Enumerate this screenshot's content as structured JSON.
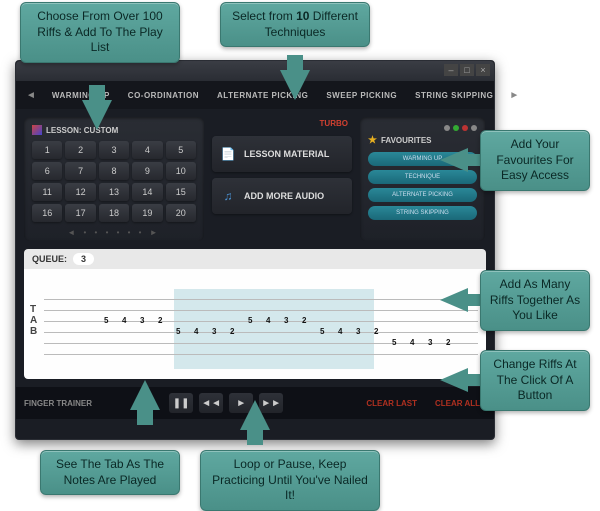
{
  "callouts": {
    "riffs": "Choose From Over 100 Riffs & Add To The Play List",
    "techniques_pre": "Select from ",
    "techniques_num": "10",
    "techniques_post": " Different Techniques",
    "favourites": "Add Your Favourites For Easy Access",
    "addmany": "Add As Many Riffs Together As You Like",
    "changeriffs": "Change Riffs At The Click Of A Button",
    "seetab": "See The Tab As The Notes Are Played",
    "loop": "Loop or Pause, Keep Practicing Until You've Nailed It!"
  },
  "nav": {
    "tabs": [
      "WARMING UP",
      "CO-ORDINATION",
      "ALTERNATE PICKING",
      "SWEEP PICKING",
      "STRING SKIPPING"
    ]
  },
  "lesson": {
    "title": "LESSON: CUSTOM",
    "numbers": [
      "1",
      "2",
      "3",
      "4",
      "5",
      "6",
      "7",
      "8",
      "9",
      "10",
      "11",
      "12",
      "13",
      "14",
      "15",
      "16",
      "17",
      "18",
      "19",
      "20"
    ]
  },
  "turbo": "TURBO",
  "actions": {
    "material": "LESSON MATERIAL",
    "addaudio": "ADD MORE AUDIO"
  },
  "fav": {
    "title": "FAVOURITES",
    "items": [
      "WARMING UP",
      "TECHNIQUE",
      "ALTERNATE PICKING",
      "STRING SKIPPING"
    ]
  },
  "queue": {
    "label": "QUEUE:",
    "count": "3"
  },
  "tab_letters": [
    "T",
    "A",
    "B"
  ],
  "controls": {
    "label": "FINGER TRAINER",
    "clearlast": "CLEAR LAST",
    "clearall": "CLEAR ALL"
  },
  "tab_notes": [
    {
      "row": 2,
      "col": 0,
      "v": "5"
    },
    {
      "row": 2,
      "col": 1,
      "v": "4"
    },
    {
      "row": 2,
      "col": 2,
      "v": "3"
    },
    {
      "row": 2,
      "col": 3,
      "v": "2"
    },
    {
      "row": 3,
      "col": 4,
      "v": "5"
    },
    {
      "row": 3,
      "col": 5,
      "v": "4"
    },
    {
      "row": 3,
      "col": 6,
      "v": "3"
    },
    {
      "row": 3,
      "col": 7,
      "v": "2"
    },
    {
      "row": 2,
      "col": 8,
      "v": "5"
    },
    {
      "row": 2,
      "col": 9,
      "v": "4"
    },
    {
      "row": 2,
      "col": 10,
      "v": "3"
    },
    {
      "row": 2,
      "col": 11,
      "v": "2"
    },
    {
      "row": 3,
      "col": 12,
      "v": "5"
    },
    {
      "row": 3,
      "col": 13,
      "v": "4"
    },
    {
      "row": 3,
      "col": 14,
      "v": "3"
    },
    {
      "row": 3,
      "col": 15,
      "v": "2"
    },
    {
      "row": 4,
      "col": 16,
      "v": "5"
    },
    {
      "row": 4,
      "col": 17,
      "v": "4"
    },
    {
      "row": 4,
      "col": 18,
      "v": "3"
    },
    {
      "row": 4,
      "col": 19,
      "v": "2"
    }
  ]
}
